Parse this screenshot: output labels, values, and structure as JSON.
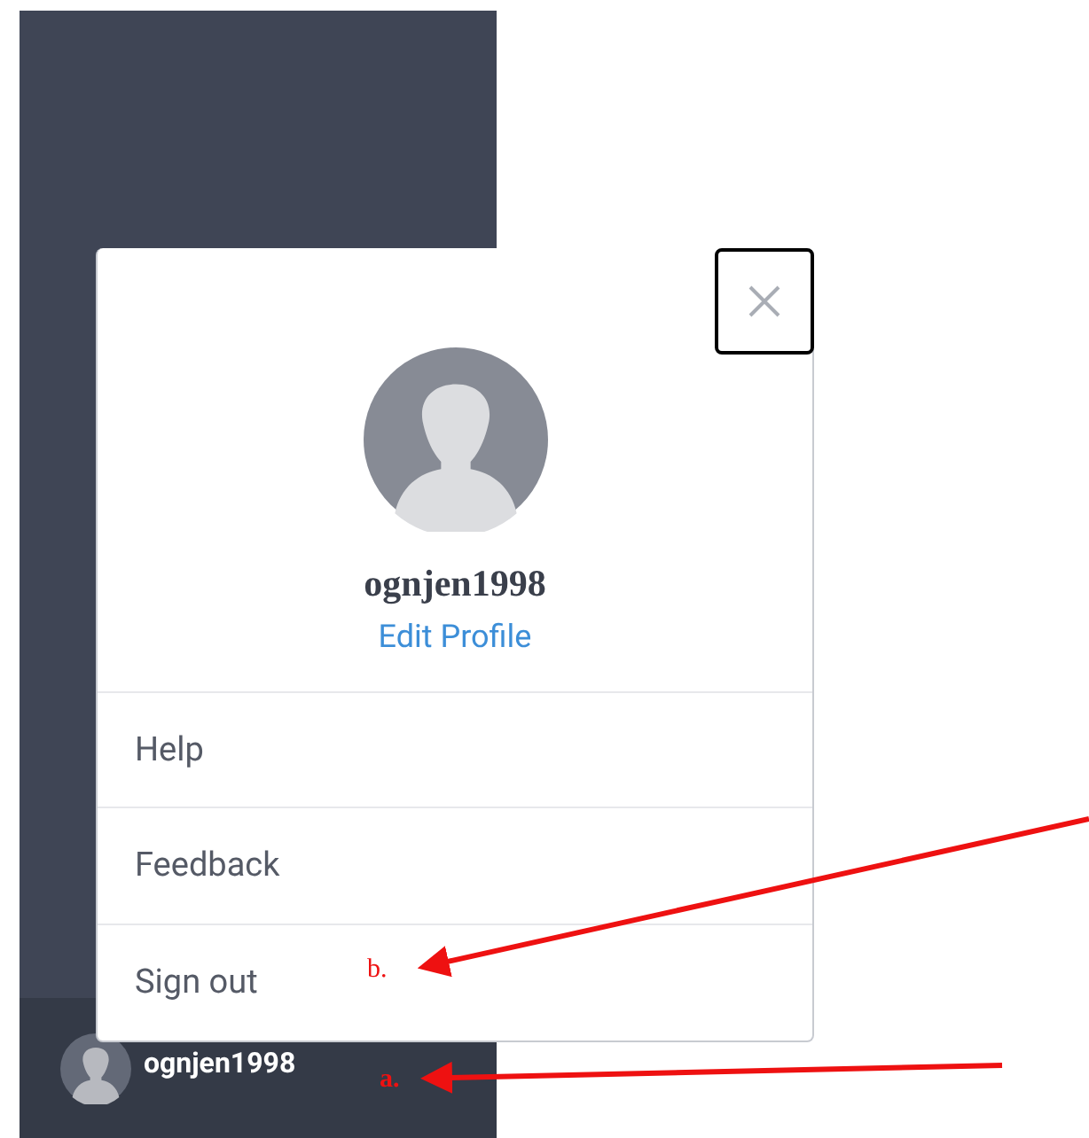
{
  "sidebar": {
    "user": {
      "name": "ognjen1998"
    }
  },
  "popup": {
    "username": "ognjen1998",
    "edit_link": "Edit Profile",
    "menu": [
      {
        "label": "Help"
      },
      {
        "label": "Feedback"
      },
      {
        "label": "Sign out"
      }
    ]
  },
  "annotations": [
    {
      "label": "b."
    },
    {
      "label": "a."
    }
  ]
}
